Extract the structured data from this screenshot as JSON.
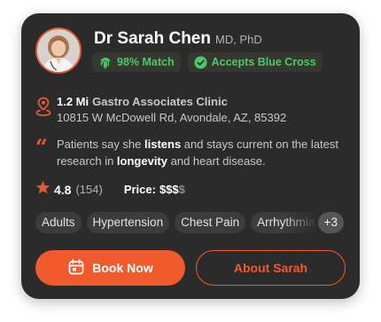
{
  "doctor": {
    "name": "Dr Sarah Chen",
    "credentials": "MD, PhD",
    "avatar_icon": "doctor-portrait"
  },
  "badges": {
    "match": {
      "label": "98% Match",
      "icon": "fingerprint-icon"
    },
    "insurance": {
      "label": "Accepts Blue Cross",
      "icon": "check-circle-icon"
    }
  },
  "location": {
    "distance": "1.2 Mi",
    "clinic": "Gastro Associates Clinic",
    "address": "10815 W McDowell Rd, Avondale, AZ, 85392",
    "icon": "map-pin-icon"
  },
  "review_quote": {
    "icon": "quote-icon",
    "before_listens": "Patients say she ",
    "listens": "listens",
    "middle": " and stays current on the latest research in ",
    "longevity": "longevity",
    "after": " and heart disease."
  },
  "stats": {
    "rating": "4.8",
    "reviews": "(154)",
    "price_label": "Price:",
    "price_active": "$$$",
    "price_inactive": "$"
  },
  "tags": {
    "items": [
      "Adults",
      "Hypertension",
      "Chest Pain",
      "Arrhythmia"
    ],
    "more": "+3"
  },
  "actions": {
    "book": "Book Now",
    "about": "About Sarah"
  },
  "colors": {
    "accent": "#f05a2c",
    "card": "#2b2b2b",
    "success": "#4cc76a",
    "star": "#e05a35"
  }
}
